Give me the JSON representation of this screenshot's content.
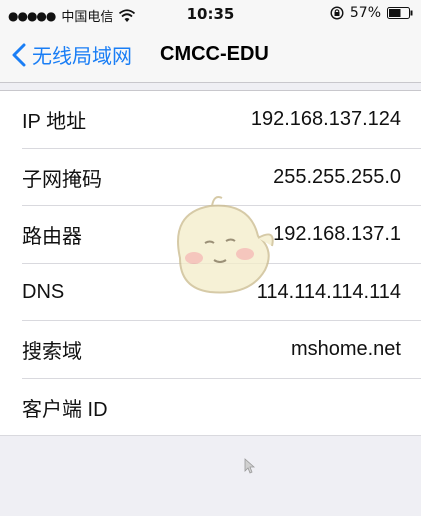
{
  "status_bar": {
    "signal_dots": "●●●●●",
    "carrier": "中国电信",
    "time": "10:35",
    "battery_percent": "57%",
    "icons": [
      "wifi-icon",
      "rotation-lock-icon",
      "battery-icon"
    ]
  },
  "nav": {
    "back_label": "无线局域网",
    "title": "CMCC-EDU",
    "accent_color": "#1a7ef5"
  },
  "rows": [
    {
      "label": "IP 地址",
      "value": "192.168.137.124"
    },
    {
      "label": "子网掩码",
      "value": "255.255.255.0"
    },
    {
      "label": "路由器",
      "value": "192.168.137.1"
    },
    {
      "label": "DNS",
      "value": "114.114.114.114"
    },
    {
      "label": "搜索域",
      "value": "mshome.net"
    },
    {
      "label": "客户端 ID",
      "value": ""
    }
  ]
}
